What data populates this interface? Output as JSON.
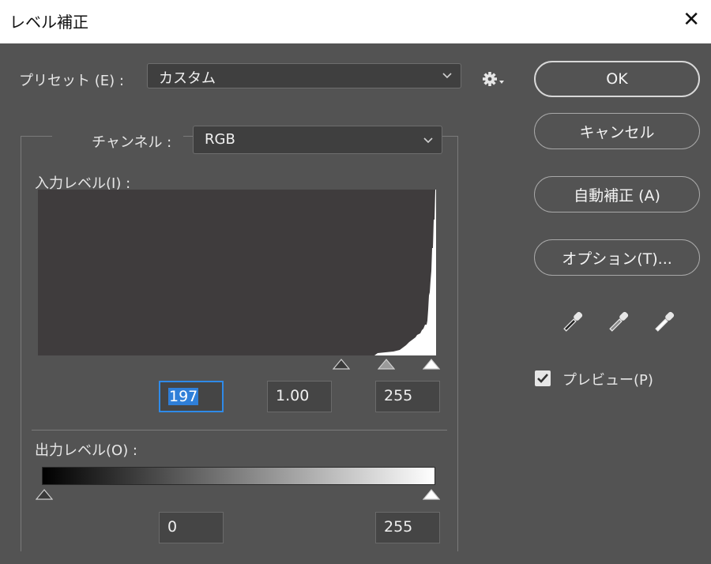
{
  "window": {
    "title": "レベル補正"
  },
  "preset": {
    "label": "プリセット (E) :",
    "value": "カスタム"
  },
  "channel": {
    "label": "チャンネル :",
    "value": "RGB"
  },
  "input_levels": {
    "label": "入力レベル(I) :",
    "black": "197",
    "gamma": "1.00",
    "white": "255"
  },
  "output_levels": {
    "label": "出力レベル(O) :",
    "black": "0",
    "white": "255"
  },
  "buttons": {
    "ok": "OK",
    "cancel": "キャンセル",
    "auto": "自動補正 (A)",
    "options": "オプション(T)..."
  },
  "preview": {
    "label": "プレビュー(P)",
    "checked": true
  },
  "icons": [
    "close-icon",
    "gear-icon",
    "chevron-down-icon",
    "black-eyedropper-icon",
    "gray-eyedropper-icon",
    "white-eyedropper-icon",
    "checkmark-icon"
  ],
  "colors": {
    "dialog_bg": "#535353",
    "histogram_bg": "#3f3c3d",
    "accent": "#2f8ae8"
  }
}
